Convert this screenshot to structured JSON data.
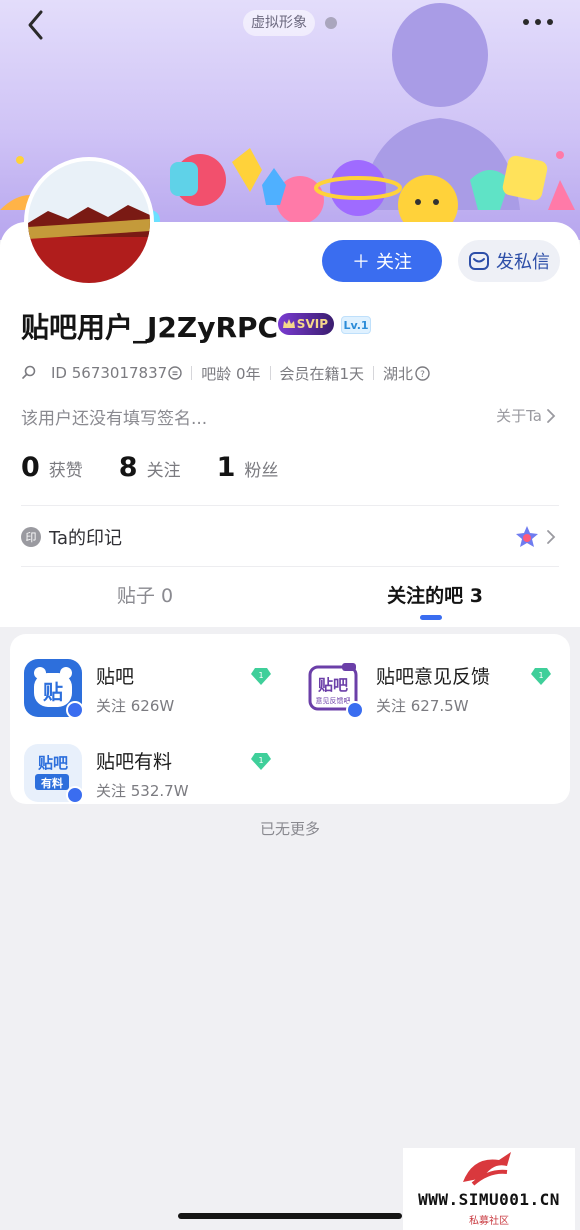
{
  "header": {
    "virtual_label": "虚拟形象"
  },
  "profile": {
    "username": "贴吧用户_J2ZyRPC",
    "svip_label": "SVIP",
    "level_label": "Lv.1",
    "follow_button": "关注",
    "message_button": "发私信",
    "meta": {
      "id": "ID 5673017837",
      "age": "吧龄 0年",
      "membership": "会员在籍1天",
      "location": "湖北"
    },
    "signature": "该用户还没有填写签名...",
    "about": "关于Ta",
    "stats": [
      {
        "num": "0",
        "label": "获赞"
      },
      {
        "num": "8",
        "label": "关注"
      },
      {
        "num": "1",
        "label": "粉丝"
      }
    ],
    "mark_icon": "印",
    "mark_label": "Ta的印记"
  },
  "tabs": [
    {
      "label": "贴子 0"
    },
    {
      "label": "关注的吧 3"
    }
  ],
  "bars": [
    {
      "name": "贴吧",
      "follow": "关注 626W",
      "logo_text": "贴"
    },
    {
      "name": "贴吧意见反馈",
      "follow": "关注 627.5W",
      "logo_text": "贴吧",
      "logo_sub": "意见反馈吧"
    },
    {
      "name": "贴吧有料",
      "follow": "关注 532.7W",
      "logo_text": "贴吧",
      "logo_sub": "有料"
    }
  ],
  "gem_level": "1",
  "footer": {
    "no_more": "已无更多"
  },
  "watermark": {
    "url": "WWW.SIMU001.CN",
    "sub": "私募社区"
  },
  "colors": {
    "accent": "#3a6df0",
    "banner": "#cfc3f6",
    "gem": "#3fcf9a"
  }
}
